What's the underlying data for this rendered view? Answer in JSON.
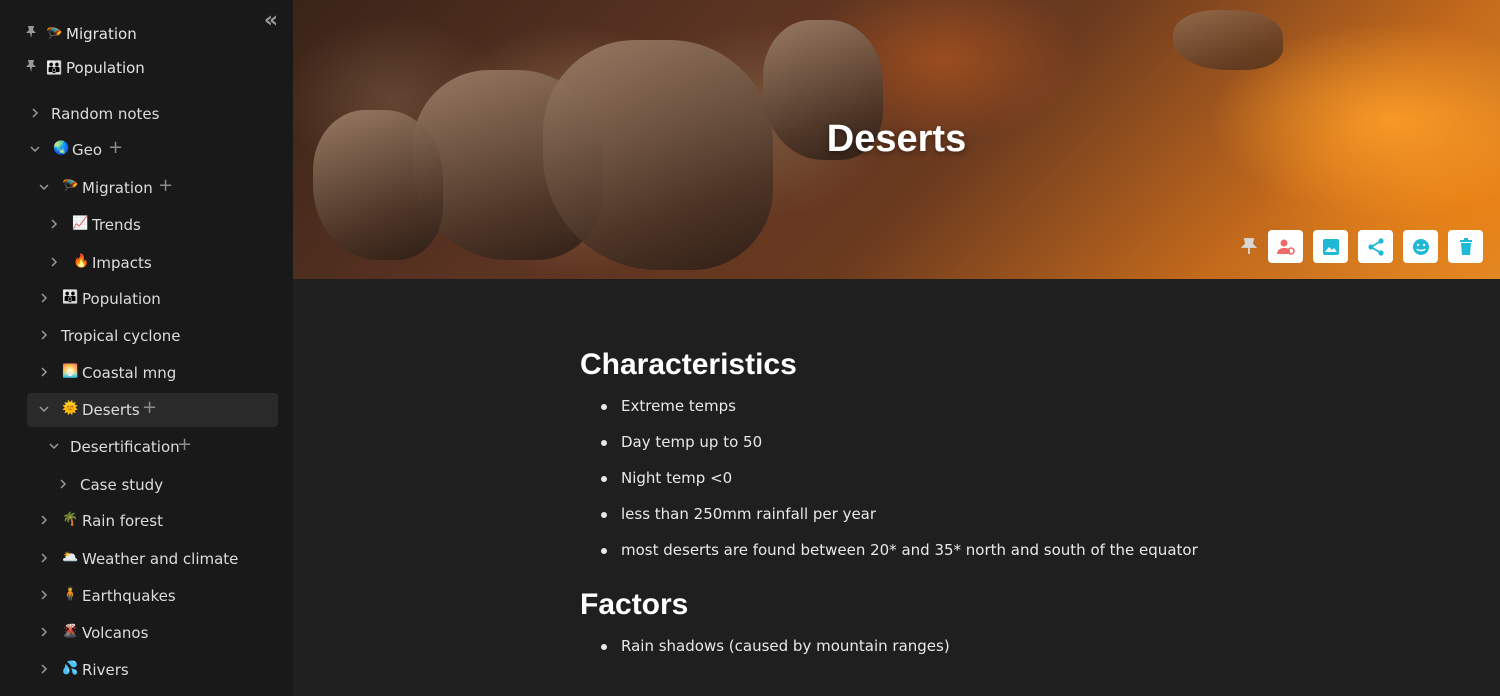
{
  "sidebar": {
    "favorites": [
      {
        "emoji": "🪂",
        "label": "Migration"
      },
      {
        "emoji": "👪",
        "label": "Population"
      }
    ],
    "tree": [
      {
        "emoji": "",
        "label": "Random notes"
      },
      {
        "emoji": "🌏",
        "label": "Geo"
      },
      {
        "emoji": "🪂",
        "label": "Migration"
      },
      {
        "emoji": "📈",
        "label": "Trends"
      },
      {
        "emoji": "🔥",
        "label": "Impacts"
      },
      {
        "emoji": "👪",
        "label": "Population"
      },
      {
        "emoji": "",
        "label": "Tropical cyclone"
      },
      {
        "emoji": "🌅",
        "label": "Coastal mng"
      },
      {
        "emoji": "🌞",
        "label": "Deserts"
      },
      {
        "emoji": "",
        "label": "Desertification"
      },
      {
        "emoji": "",
        "label": "Case study"
      },
      {
        "emoji": "🌴",
        "label": "Rain forest"
      },
      {
        "emoji": "🌥️",
        "label": "Weather and climate"
      },
      {
        "emoji": "🧍",
        "label": "Earthquakes"
      },
      {
        "emoji": "🌋",
        "label": "Volcanos"
      },
      {
        "emoji": "💦",
        "label": "Rivers"
      }
    ]
  },
  "page": {
    "title": "Deserts",
    "toolbar_icons": [
      "pin-icon",
      "user-settings-icon",
      "image-icon",
      "share-icon",
      "emoji-icon",
      "trash-icon"
    ],
    "accent_color": "#1fb8d6"
  },
  "content": {
    "sections": [
      {
        "heading": "Characteristics",
        "bullets": [
          "Extreme temps",
          "Day temp up to 50",
          "Night temp <0",
          "less than 250mm rainfall per year",
          "most deserts are found between 20* and 35* north and south of the equator"
        ]
      },
      {
        "heading": "Factors",
        "bullets": [
          "Rain shadows (caused by mountain ranges)"
        ]
      }
    ]
  }
}
